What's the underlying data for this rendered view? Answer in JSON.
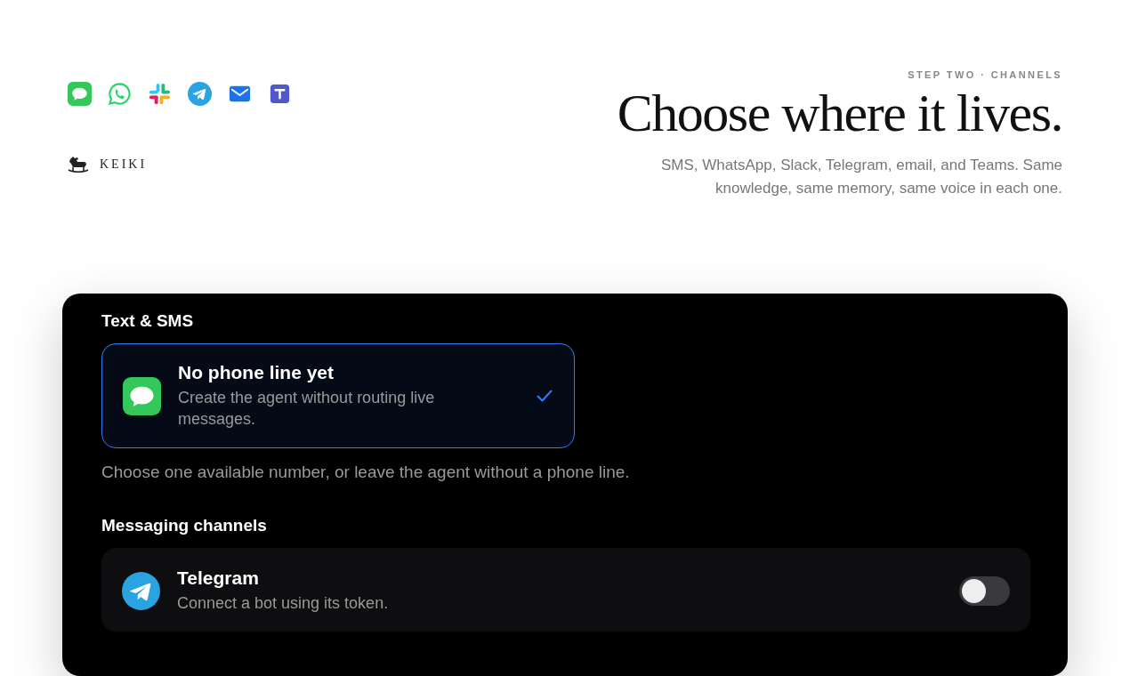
{
  "channel_icons": [
    {
      "kind": "messages"
    },
    {
      "kind": "whatsapp"
    },
    {
      "kind": "slack"
    },
    {
      "kind": "telegram"
    },
    {
      "kind": "email"
    },
    {
      "kind": "teams"
    }
  ],
  "brand": {
    "name": "KEIKI"
  },
  "header": {
    "eyebrow": "STEP TWO · CHANNELS",
    "title": "Choose where it lives.",
    "subtitle": "SMS, WhatsApp, Slack, Telegram, email, and Teams. Same knowledge, same memory, same voice in each one."
  },
  "sections": [
    {
      "heading": "Text & SMS",
      "kind": "options",
      "options": [
        {
          "kind": "messages",
          "title": "No phone line yet",
          "description": "Create the agent without routing live messages.",
          "selected": true
        }
      ],
      "help": "Choose one available number, or leave the agent without a phone line."
    },
    {
      "heading": "Messaging channels",
      "kind": "toggles",
      "items": [
        {
          "kind": "telegram",
          "title": "Telegram",
          "description": "Connect a bot using its token.",
          "on": false
        }
      ]
    }
  ]
}
